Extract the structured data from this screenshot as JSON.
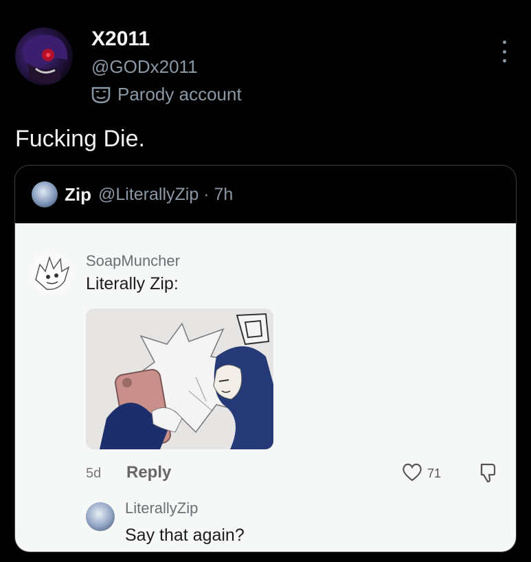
{
  "post": {
    "display_name": "X2011",
    "handle": "@GODx2011",
    "account_label": "Parody account",
    "text": "Fucking Die."
  },
  "quote": {
    "name": "Zip",
    "meta": "@LiterallyZip · 7h"
  },
  "comment": {
    "author": "SoapMuncher",
    "text": "Literally Zip:",
    "age": "5d",
    "reply_label": "Reply",
    "likes": "71"
  },
  "reply": {
    "author": "LiterallyZip",
    "text": "Say that again?"
  },
  "icons": {
    "more": "more-vertical-icon",
    "parody": "mask-icon",
    "like": "heart-icon",
    "dislike": "thumbs-down-icon"
  },
  "colors": {
    "background": "#000000",
    "muted_text": "#8b98a5",
    "panel": "#f6f7f7"
  }
}
